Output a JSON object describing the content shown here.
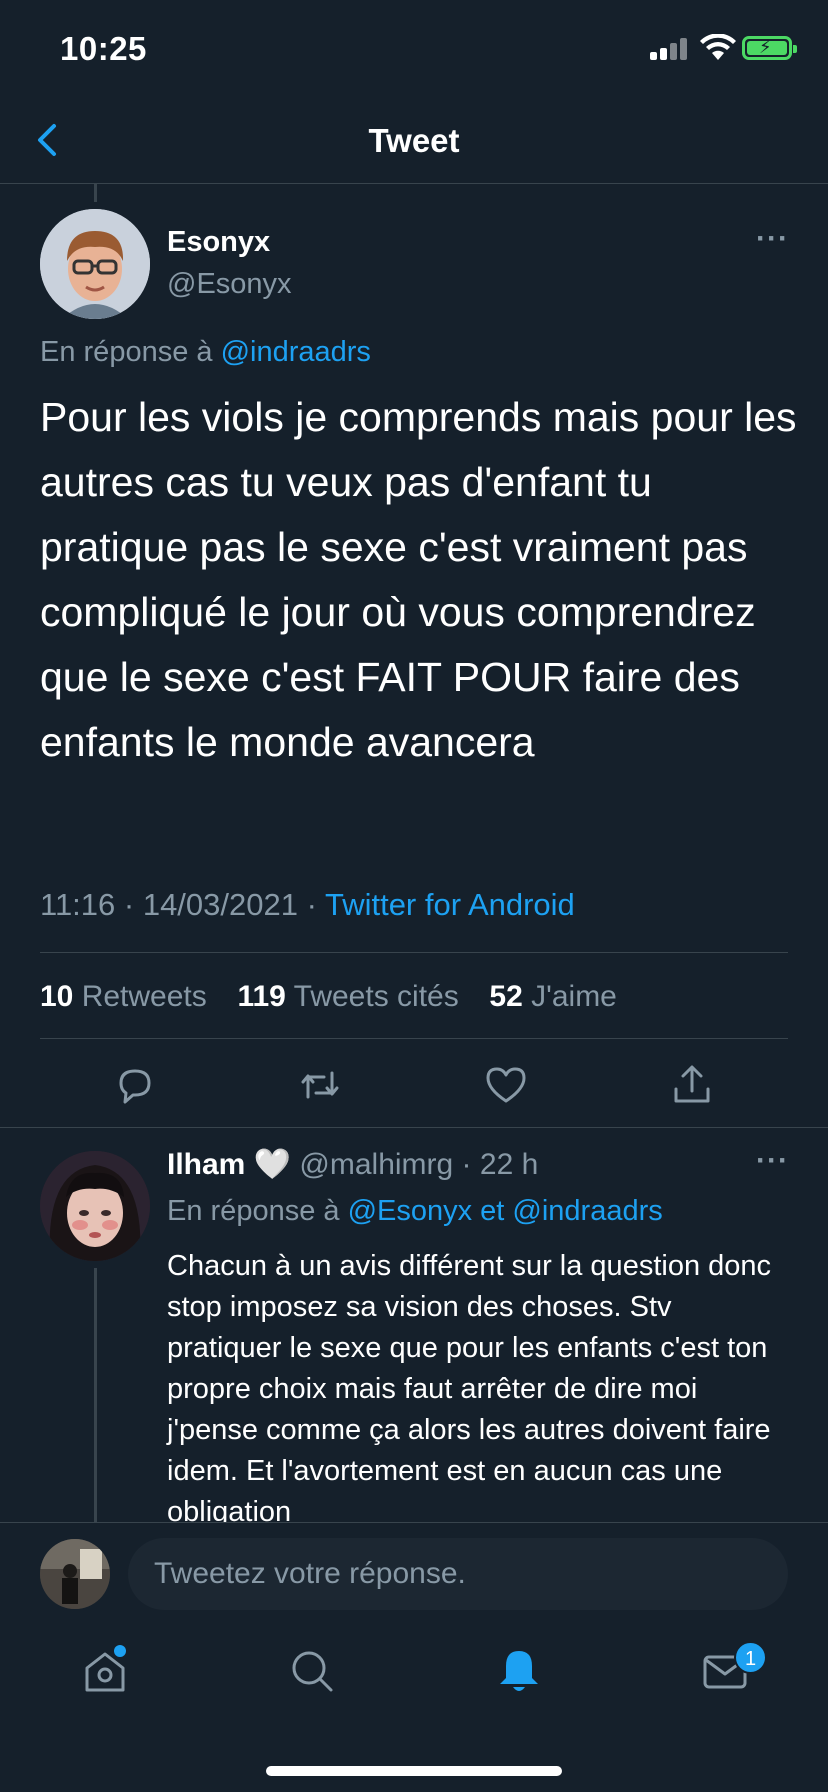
{
  "status_bar": {
    "time": "10:25"
  },
  "nav": {
    "title": "Tweet"
  },
  "main_tweet": {
    "author_name": "Esonyx",
    "author_handle": "@Esonyx",
    "reply_to_prefix": "En réponse à ",
    "reply_to_user": "@indraadrs",
    "text": "Pour les viols je comprends mais pour les autres cas tu veux pas d'enfant tu pratique pas le sexe c'est vraiment pas compliqué le jour où vous comprendrez que le sexe c'est FAIT POUR faire des enfants le monde avancera",
    "timestamp": "11:16 · 14/03/2021 · ",
    "source": "Twitter for Android",
    "stats": {
      "retweets_count": "10",
      "retweets_label": " Retweets",
      "quotes_count": "119",
      "quotes_label": " Tweets cités",
      "likes_count": "52",
      "likes_label": " J'aime"
    }
  },
  "reply": {
    "author_name": "Ilham",
    "emoji": "🤍",
    "handle": "@malhimrg",
    "time": " · 22 h",
    "reply_to_prefix": "En réponse à ",
    "reply_to_users": "@Esonyx et @indraadrs",
    "text": "Chacun à un avis différent sur la question donc stop imposez sa vision des choses. Stv pratiquer le sexe que pour les enfants c'est ton propre choix mais faut arrêter de dire moi j'pense comme ça alors les autres doivent faire idem. Et l'avortement est en aucun cas une obligation"
  },
  "compose": {
    "placeholder": "Tweetez votre réponse."
  },
  "tab_bar": {
    "messages_badge": "1"
  },
  "colors": {
    "background": "#15202b",
    "accent": "#1da1f2",
    "muted": "#8899a6",
    "divider": "#38444d"
  },
  "icons": {
    "nav": "back-arrow-icon",
    "actions": [
      "reply-icon",
      "retweet-icon",
      "like-icon",
      "share-icon"
    ],
    "tabs": [
      "home-icon",
      "search-icon",
      "notifications-icon",
      "messages-icon"
    ]
  }
}
